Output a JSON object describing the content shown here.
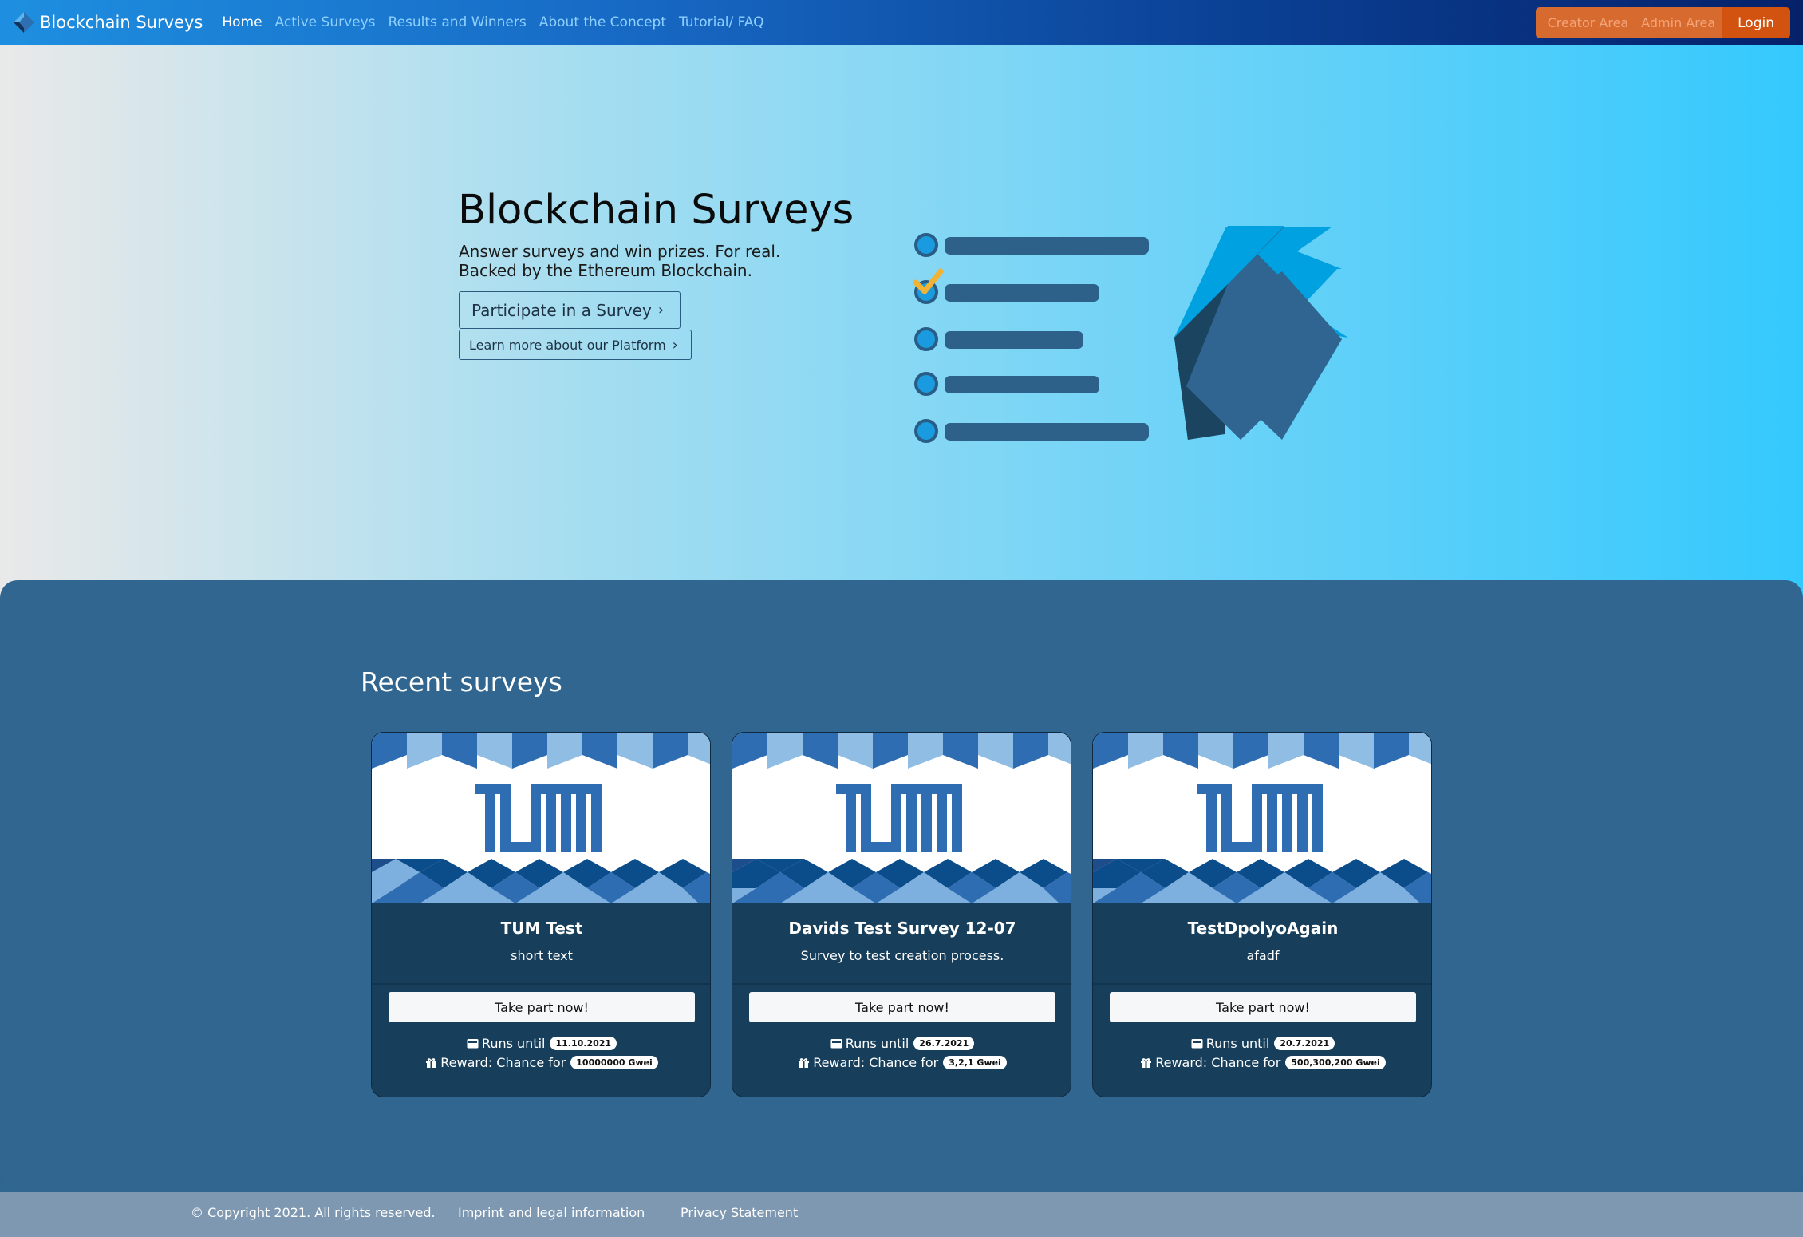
{
  "nav": {
    "brand": "Blockchain Surveys",
    "links": [
      "Home",
      "Active Surveys",
      "Results and Winners",
      "About the Concept",
      "Tutorial/ FAQ"
    ],
    "creator_area": "Creator Area",
    "admin_area": "Admin Area",
    "login": "Login"
  },
  "hero": {
    "title": "Blockchain Surveys",
    "subtitle_line1": "Answer surveys and win prizes. For real.",
    "subtitle_line2": "Backed by the Ethereum Blockchain.",
    "primary_button": "Participate in a Survey",
    "secondary_button": "Learn more about our Platform"
  },
  "recent": {
    "title": "Recent surveys",
    "take_part_label": "Take part now!",
    "runs_label": "Runs until",
    "reward_label": "Reward: Chance for",
    "cards": [
      {
        "title": "TUM Test",
        "description": "short text",
        "runs_until": "11.10.2021",
        "reward": "10000000 Gwei"
      },
      {
        "title": "Davids Test Survey 12-07",
        "description": "Survey to test creation process.",
        "runs_until": "26.7.2021",
        "reward": "3,2,1 Gwei"
      },
      {
        "title": "TestDpolyoAgain",
        "description": "afadf",
        "runs_until": "20.7.2021",
        "reward": "500,300,200 Gwei"
      }
    ]
  },
  "footer": {
    "copyright": "© Copyright 2021. All rights reserved.",
    "imprint": "Imprint and legal information",
    "privacy": "Privacy Statement"
  },
  "colors": {
    "section_bg": "#30668f",
    "card_bg": "#173f5b",
    "login_bg": "#d2530f",
    "accent_check": "#f2b233"
  }
}
